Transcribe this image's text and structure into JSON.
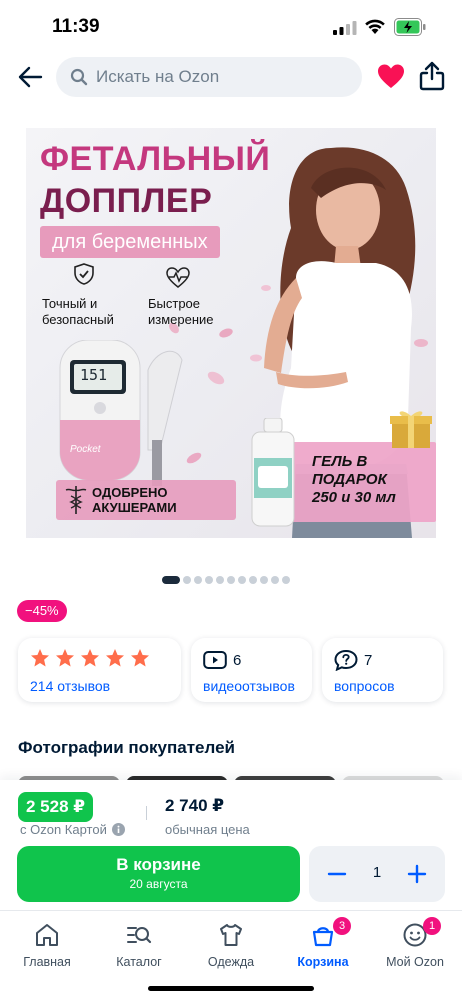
{
  "status_bar": {
    "time": "11:39"
  },
  "header": {
    "search_placeholder": "Искать на Ozon"
  },
  "product_image": {
    "title_line1": "ФЕТАЛЬНЫЙ",
    "title_line2": "ДОППЛЕР",
    "subtitle": "для беременных",
    "feature1": [
      "Точный и",
      "безопасный"
    ],
    "feature2": [
      "Быстрое",
      "измерение"
    ],
    "device_reading": "151",
    "approved": [
      "ОДОБРЕНО",
      "АКУШЕРАМИ"
    ],
    "gift": [
      "ГЕЛЬ В",
      "ПОДАРОК",
      "250 и 30 мл"
    ],
    "brand": "Pocket"
  },
  "gallery": {
    "total": 11,
    "active_index": 0
  },
  "discount_badge": "−45%",
  "stats": {
    "rating_stars": 5,
    "reviews_link": "214 отзывов",
    "video_count": "6",
    "video_link": "видеоотзывов",
    "questions_count": "7",
    "questions_link": "вопросов"
  },
  "buyer_photos": {
    "title": "Фотографии покупателей"
  },
  "buy_panel": {
    "ozon_price": "2 528 ₽",
    "ozon_label": "с Ozon Картой",
    "regular_price": "2 740 ₽",
    "regular_label": "обычная цена",
    "cart_button": "В корзине",
    "delivery_date": "20 августа",
    "quantity": "1"
  },
  "tabbar": {
    "items": [
      {
        "label": "Главная",
        "icon": "home-icon"
      },
      {
        "label": "Каталог",
        "icon": "catalog-icon"
      },
      {
        "label": "Одежда",
        "icon": "clothes-icon"
      },
      {
        "label": "Корзина",
        "icon": "cart-icon",
        "badge": "3",
        "active": true
      },
      {
        "label": "Мой Ozon",
        "icon": "profile-icon",
        "badge": "1"
      }
    ]
  },
  "colors": {
    "accent_blue": "#005bff",
    "ozon_green": "#10c44c",
    "badge_pink": "#f1117e",
    "star_orange": "#ff6d4b",
    "heart_pink": "#f91155"
  }
}
